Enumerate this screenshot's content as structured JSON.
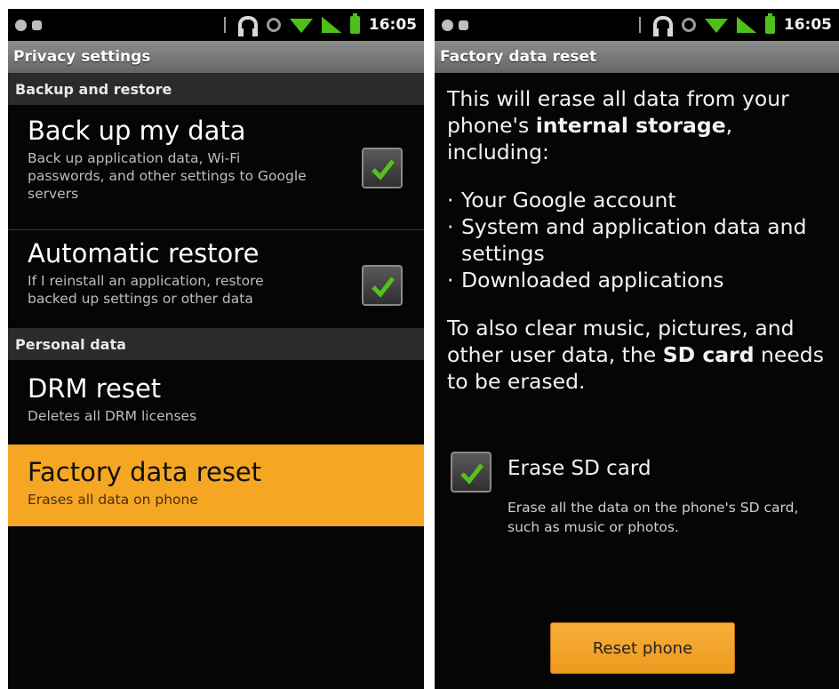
{
  "status_bar": {
    "time": "16:05"
  },
  "left_screen": {
    "title": "Privacy settings",
    "sections": {
      "backup": {
        "header": "Backup and restore",
        "items": [
          {
            "title": "Back up my data",
            "summary": "Back up application data, Wi-Fi passwords, and other settings to Google servers",
            "checked": true
          },
          {
            "title": "Automatic restore",
            "summary": "If I reinstall an application, restore backed up settings or other data",
            "checked": true
          }
        ]
      },
      "personal": {
        "header": "Personal data",
        "items": [
          {
            "title": "DRM reset",
            "summary": "Deletes all DRM licenses"
          },
          {
            "title": "Factory data reset",
            "summary": "Erases all data on phone",
            "highlighted": true
          }
        ]
      }
    }
  },
  "right_screen": {
    "title": "Factory data reset",
    "intro_prefix": "This will erase all data from your phone's ",
    "intro_bold": "internal storage",
    "intro_suffix": ", including:",
    "list": [
      "Your Google account",
      "System and application data and settings",
      "Downloaded applications"
    ],
    "para2_prefix": "To also clear music, pictures, and other user data, the ",
    "para2_bold": "SD card",
    "para2_suffix": " needs to be erased.",
    "erase_sd": {
      "title": "Erase SD card",
      "summary": "Erase all the data on the phone's SD card, such as music or photos.",
      "checked": true
    },
    "reset_button": "Reset phone"
  },
  "colors": {
    "highlight": "#f5a623",
    "check_green": "#55c21e",
    "background": "#050505"
  },
  "icons": [
    "bluetooth-icon",
    "headphones-icon",
    "sync-icon",
    "wifi-icon",
    "signal-icon",
    "battery-icon",
    "checkmark-icon"
  ]
}
